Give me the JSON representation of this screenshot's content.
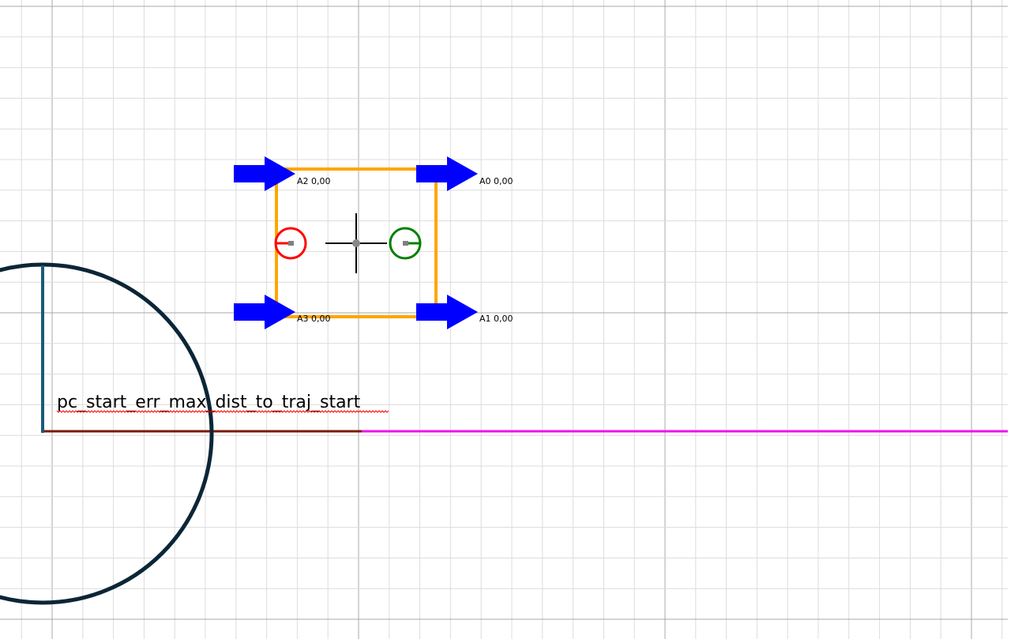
{
  "colors": {
    "background": "#ffffff",
    "grid_minor": "#dcdcdc",
    "grid_major": "#a8a8a8",
    "robot_outline": "#ffa500",
    "thruster_arrow": "#0000ff",
    "marker_red": "#ff0000",
    "marker_green": "#008000",
    "tolerance_circle": "#0b2636",
    "radius_line": "#1a5a7a",
    "traj_start_segment": "#7a1a00",
    "trajectory": "#ee11ee",
    "spellcheck": "#ff0000"
  },
  "thrusters": [
    {
      "id": "A2",
      "value": "0,00",
      "label": "A2 0,00"
    },
    {
      "id": "A0",
      "value": "0,00",
      "label": "A0 0,00"
    },
    {
      "id": "A3",
      "value": "0,00",
      "label": "A3 0,00"
    },
    {
      "id": "A1",
      "value": "0,00",
      "label": "A1 0,00"
    }
  ],
  "annotation": {
    "text": "pc_start_err_max_dist_to_traj_start"
  },
  "icons": {
    "thruster": "arrow-right-icon",
    "center": "crosshair-icon",
    "start_marker": "circle-marker-icon"
  }
}
